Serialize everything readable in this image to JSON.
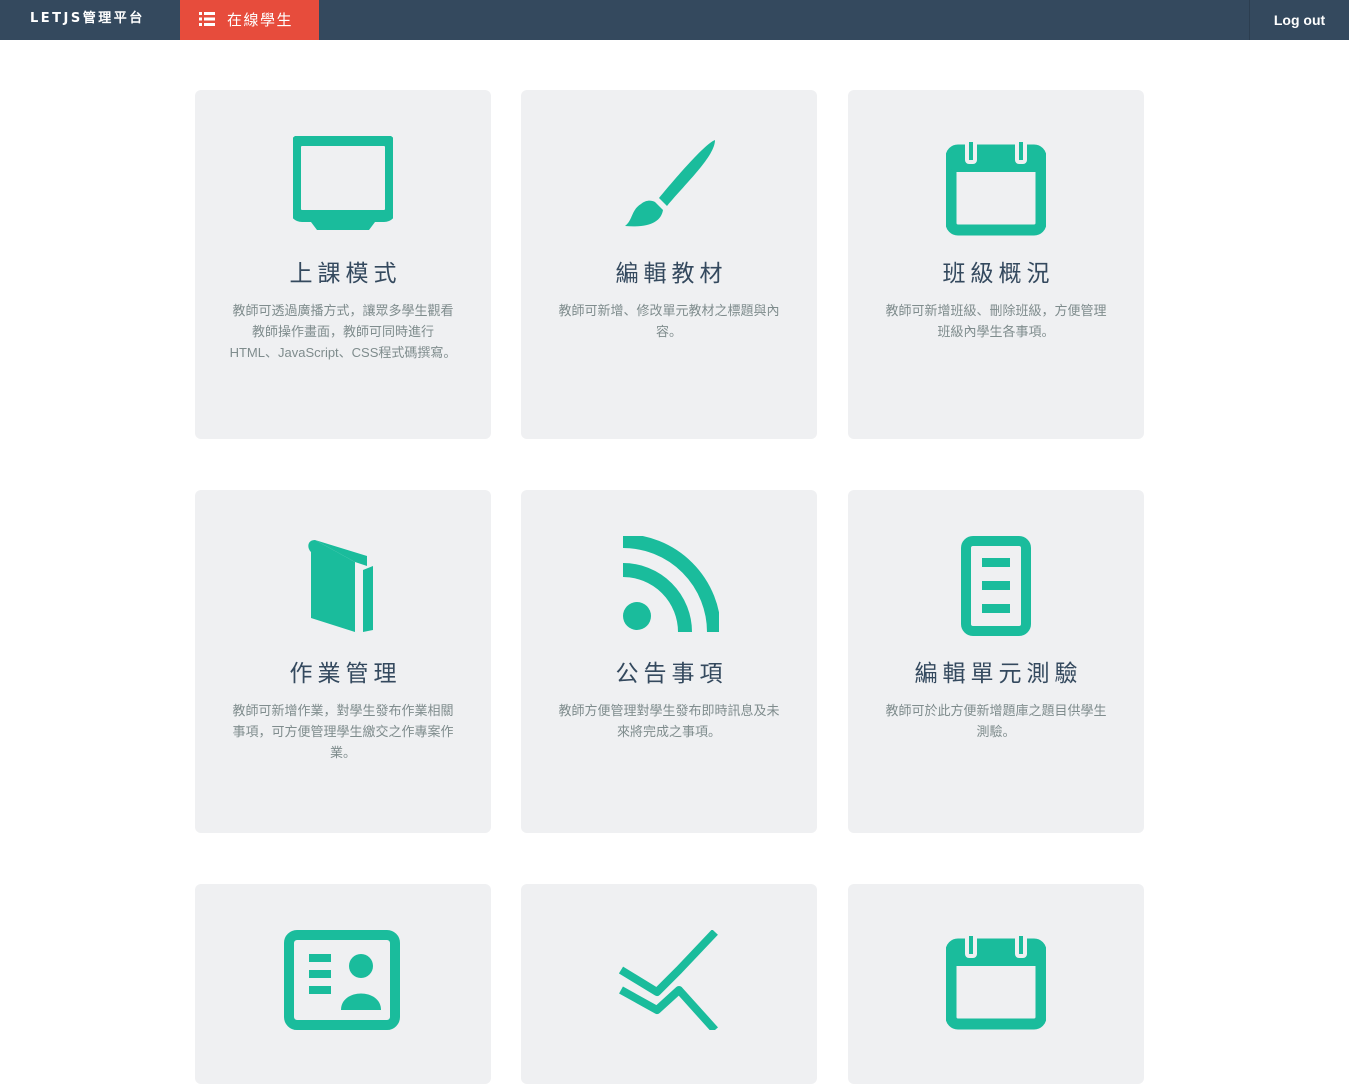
{
  "navbar": {
    "brand": "LETJS管理平台",
    "online_students": "在線學生",
    "logout": "Log out"
  },
  "colors": {
    "navbar_bg": "#34495e",
    "active_tab": "#e74c3c",
    "icon_accent": "#1abc9c",
    "card_bg": "#eff0f2",
    "title_text": "#34495e",
    "desc_text": "#7f8c8d"
  },
  "cards": [
    {
      "icon": "monitor-icon",
      "title": "上課模式",
      "description": "教師可透過廣播方式，讓眾多學生觀看教師操作畫面，教師可同時進行HTML、JavaScript、CSS程式碼撰寫。"
    },
    {
      "icon": "paintbrush-icon",
      "title": "編輯教材",
      "description": "教師可新增、修改單元教材之標題與內容。"
    },
    {
      "icon": "calendar-icon",
      "title": "班級概況",
      "description": "教師可新增班級、刪除班級，方便管理班級內學生各事項。"
    },
    {
      "icon": "book-icon",
      "title": "作業管理",
      "description": "教師可新增作業，對學生發布作業相關事項，可方便管理學生繳交之作專案作業。"
    },
    {
      "icon": "rss-icon",
      "title": "公告事項",
      "description": "教師方便管理對學生發布即時訊息及未來將完成之事項。"
    },
    {
      "icon": "document-list-icon",
      "title": "編輯單元測驗",
      "description": "教師可於此方便新增題庫之題目供學生測驗。"
    },
    {
      "icon": "id-card-icon",
      "title": "",
      "description": ""
    },
    {
      "icon": "stats-chart-icon",
      "title": "",
      "description": ""
    },
    {
      "icon": "calendar-icon",
      "title": "",
      "description": ""
    }
  ]
}
